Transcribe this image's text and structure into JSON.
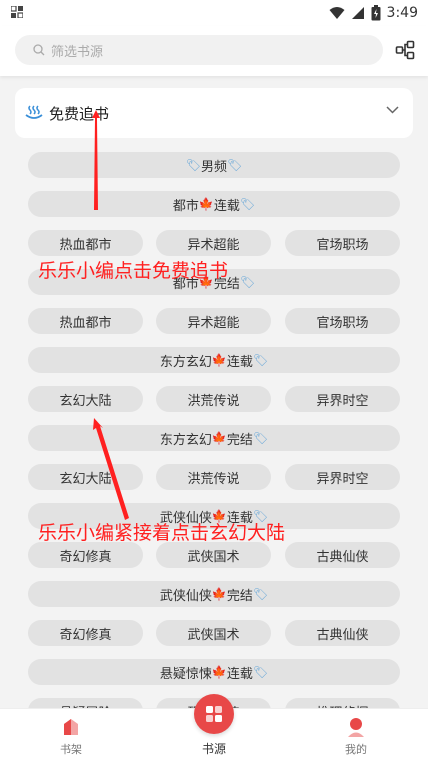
{
  "status_bar": {
    "time": "3:49"
  },
  "search": {
    "placeholder": "筛选书源"
  },
  "section": {
    "title": "免费追书"
  },
  "headers": {
    "male": "男频",
    "urban_serial": "都市",
    "urban_serial_suffix": "连载",
    "urban_done": "都市",
    "urban_done_suffix": "完结",
    "east_serial": "东方玄幻",
    "east_serial_suffix": "连载",
    "east_done": "东方玄幻",
    "east_done_suffix": "完结",
    "wuxia_serial": "武侠仙侠",
    "wuxia_serial_suffix": "连载",
    "wuxia_done": "武侠仙侠",
    "wuxia_done_suffix": "完结",
    "mystery_serial": "悬疑惊悚",
    "mystery_serial_suffix": "连载"
  },
  "rows": {
    "urban1": [
      "热血都市",
      "异术超能",
      "官场职场"
    ],
    "urban2": [
      "热血都市",
      "异术超能",
      "官场职场"
    ],
    "east1": [
      "玄幻大陆",
      "洪荒传说",
      "异界时空"
    ],
    "east2": [
      "玄幻大陆",
      "洪荒传说",
      "异界时空"
    ],
    "wuxia1": [
      "奇幻修真",
      "武侠国术",
      "古典仙侠"
    ],
    "wuxia2": [
      "奇幻修真",
      "武侠国术",
      "古典仙侠"
    ],
    "mystery1": [
      "悬疑冒险",
      "恐怖惊悚",
      "推理侦探"
    ]
  },
  "annotations": {
    "first": "乐乐小编点击免费追书",
    "second": "乐乐小编紧接着点击玄幻大陆"
  },
  "nav": {
    "bookshelf": "书架",
    "sources": "书源",
    "mine": "我的"
  },
  "colors": {
    "accent": "#e84848",
    "annotation": "#ff2020",
    "pill": "#e2e2e2"
  }
}
